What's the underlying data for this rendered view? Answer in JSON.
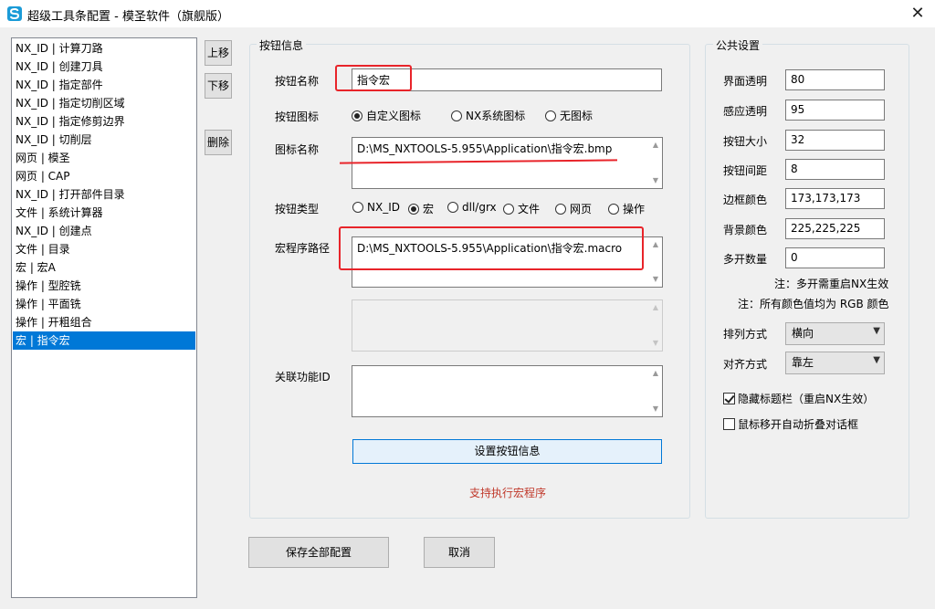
{
  "window": {
    "title": "超级工具条配置 - 模圣软件（旗舰版）",
    "close_glyph": "✕"
  },
  "list": {
    "items": [
      "NX_ID | 计算刀路",
      "NX_ID | 创建刀具",
      "NX_ID | 指定部件",
      "NX_ID | 指定切削区域",
      "NX_ID | 指定修剪边界",
      "NX_ID | 切削层",
      "网页 | 模圣",
      "网页 | CAP",
      "NX_ID | 打开部件目录",
      "文件 | 系统计算器",
      "NX_ID | 创建点",
      "文件 | 目录",
      "宏 | 宏A",
      "操作 | 型腔铣",
      "操作 | 平面铣",
      "操作 | 开粗组合",
      "宏 | 指令宏"
    ],
    "selected_index": 16
  },
  "side_buttons": {
    "move_up": "上移",
    "move_down": "下移",
    "delete": "删除"
  },
  "button_info": {
    "group_title": "按钮信息",
    "name_label": "按钮名称",
    "name_value": "指令宏",
    "icon_label": "按钮图标",
    "icon_options": [
      "自定义图标",
      "NX系统图标",
      "无图标"
    ],
    "icon_selected": 0,
    "icon_name_label": "图标名称",
    "icon_name_value": "D:\\MS_NXTOOLS-5.955\\Application\\指令宏.bmp",
    "type_label": "按钮类型",
    "type_options": [
      "NX_ID",
      "宏",
      "dll/grx",
      "文件",
      "网页",
      "操作"
    ],
    "type_selected": 1,
    "macro_path_label": "宏程序路径",
    "macro_path_value": "D:\\MS_NXTOOLS-5.955\\Application\\指令宏.macro",
    "related_id_label": "关联功能ID",
    "related_id_value": "",
    "set_button_label": "设置按钮信息",
    "status_note": "支持执行宏程序"
  },
  "public_settings": {
    "group_title": "公共设置",
    "fields": [
      {
        "label": "界面透明",
        "value": "80"
      },
      {
        "label": "感应透明",
        "value": "95"
      },
      {
        "label": "按钮大小",
        "value": "32"
      },
      {
        "label": "按钮间距",
        "value": "8"
      },
      {
        "label": "边框颜色",
        "value": "173,173,173"
      },
      {
        "label": "背景颜色",
        "value": "225,225,225"
      },
      {
        "label": "多开数量",
        "value": "0"
      }
    ],
    "note1": "注：多开需重启NX生效",
    "note2": "注：所有颜色值均为 RGB 颜色",
    "arrange_label": "排列方式",
    "arrange_value": "横向",
    "align_label": "对齐方式",
    "align_value": "靠左",
    "hide_titlebar_label": "隐藏标题栏（重启NX生效）",
    "hide_titlebar_checked": true,
    "auto_fold_label": "鼠标移开自动折叠对话框",
    "auto_fold_checked": false
  },
  "footer": {
    "save_all": "保存全部配置",
    "cancel": "取消"
  },
  "colors": {
    "accent": "#0078d7",
    "highlight": "#e8242a",
    "note": "#c0392b"
  }
}
